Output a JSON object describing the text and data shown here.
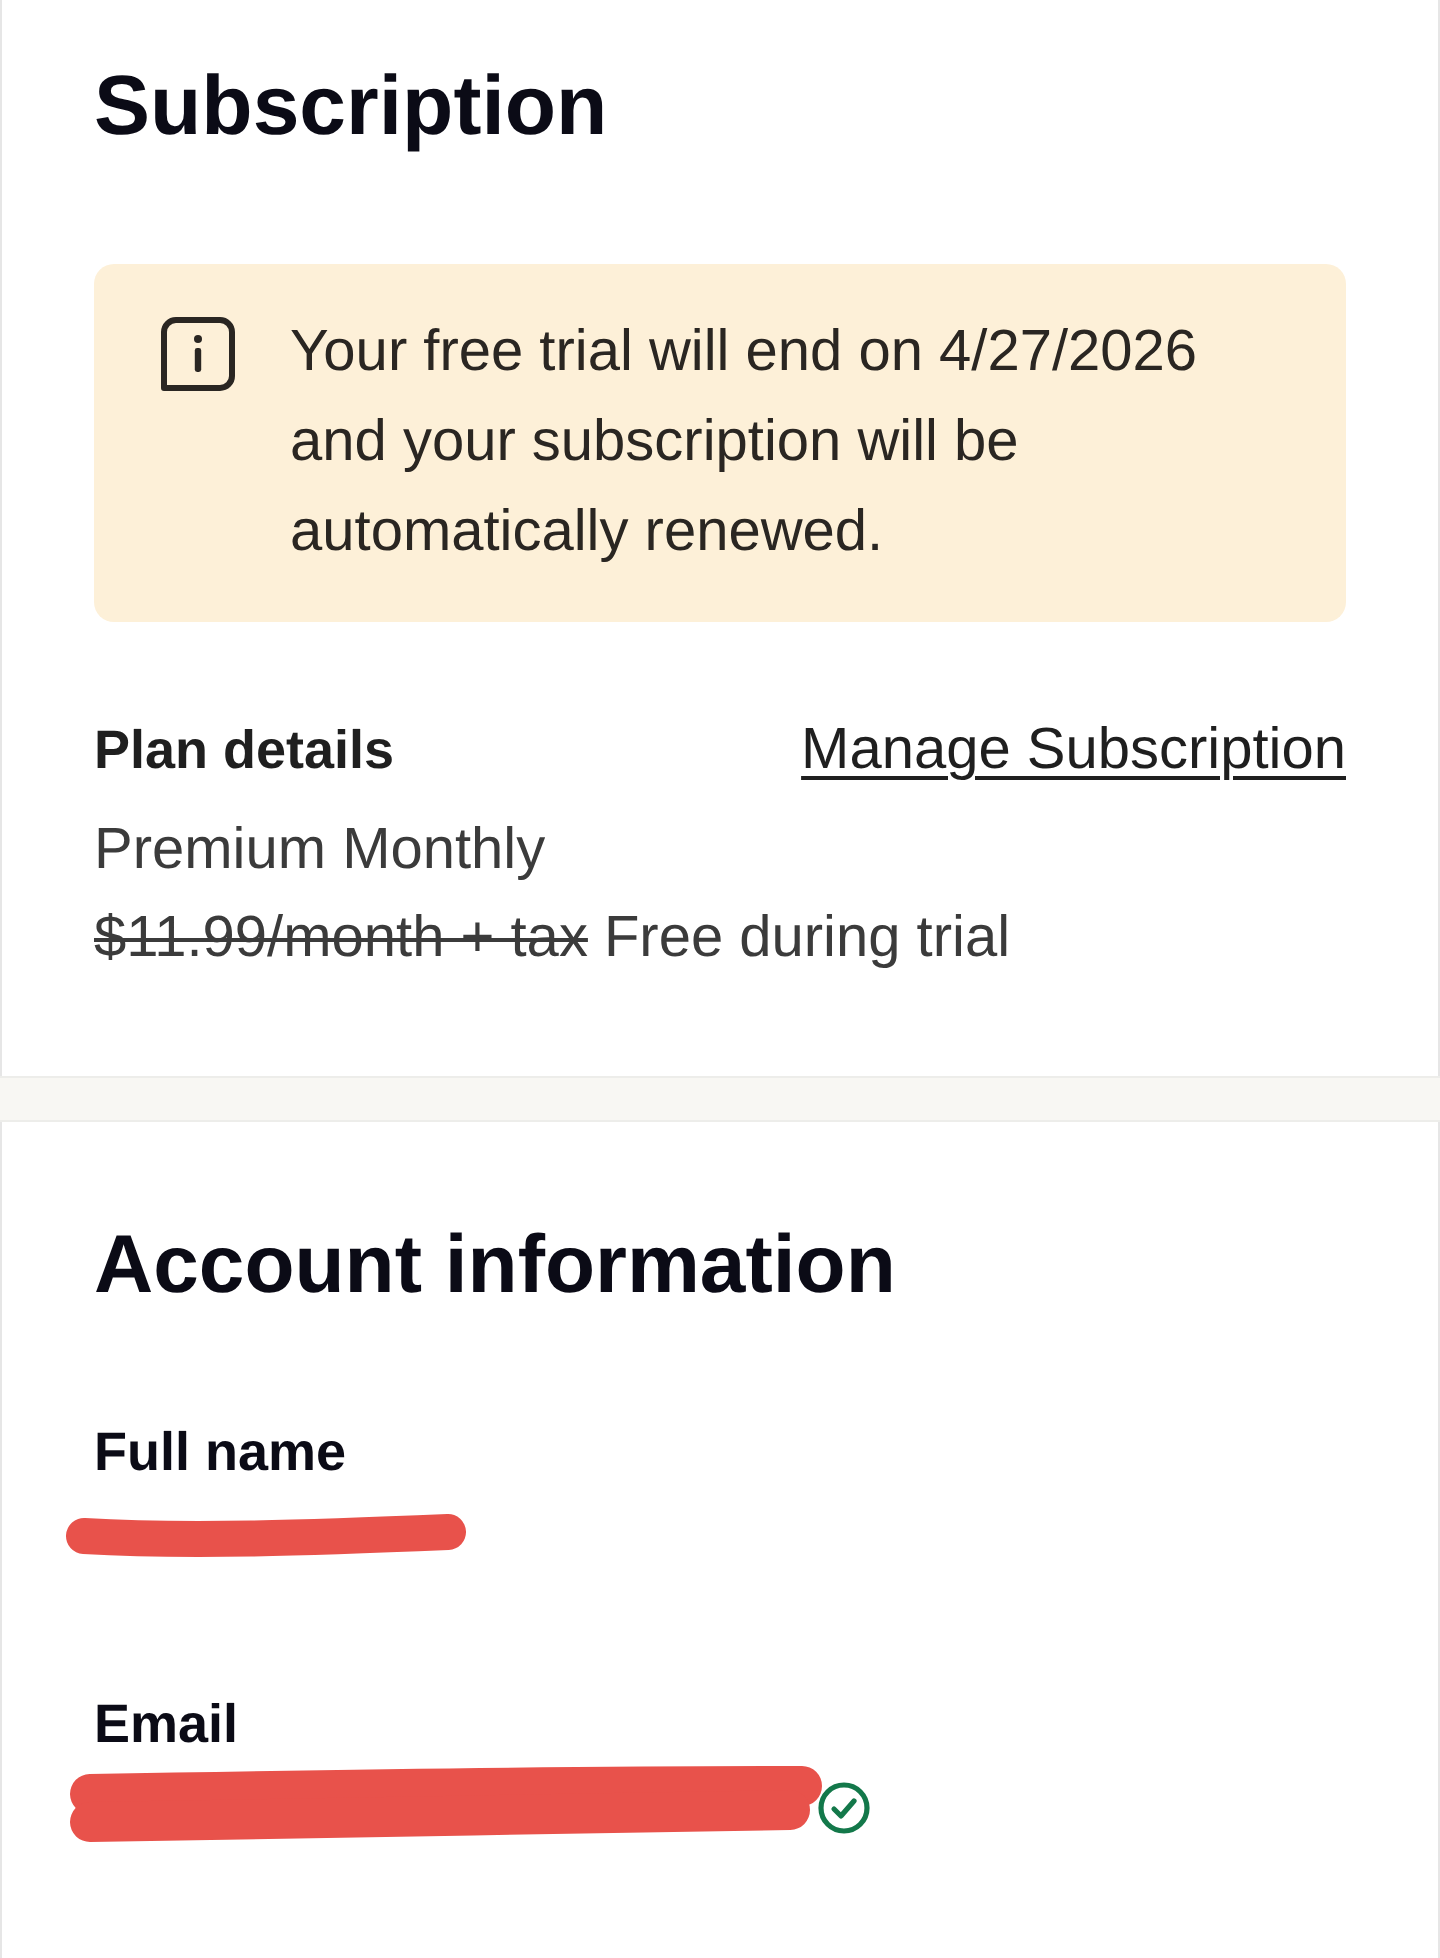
{
  "subscription": {
    "title": "Subscription",
    "notice": {
      "kind": "info",
      "text": "Your free trial will end on 4/27/2026 and your subscription will be automatically renewed."
    },
    "plan": {
      "label": "Plan details",
      "link": "Manage Subscription",
      "name": "Premium Monthly",
      "regular_price": "$11.99/month + tax",
      "regular_price_struck": true,
      "trial_price": "Free during trial"
    }
  },
  "account": {
    "title": "Account information",
    "fields": [
      {
        "label": "Full name",
        "redacted": true,
        "verified": false
      },
      {
        "label": "Email",
        "redacted": true,
        "verified": true
      }
    ]
  }
}
